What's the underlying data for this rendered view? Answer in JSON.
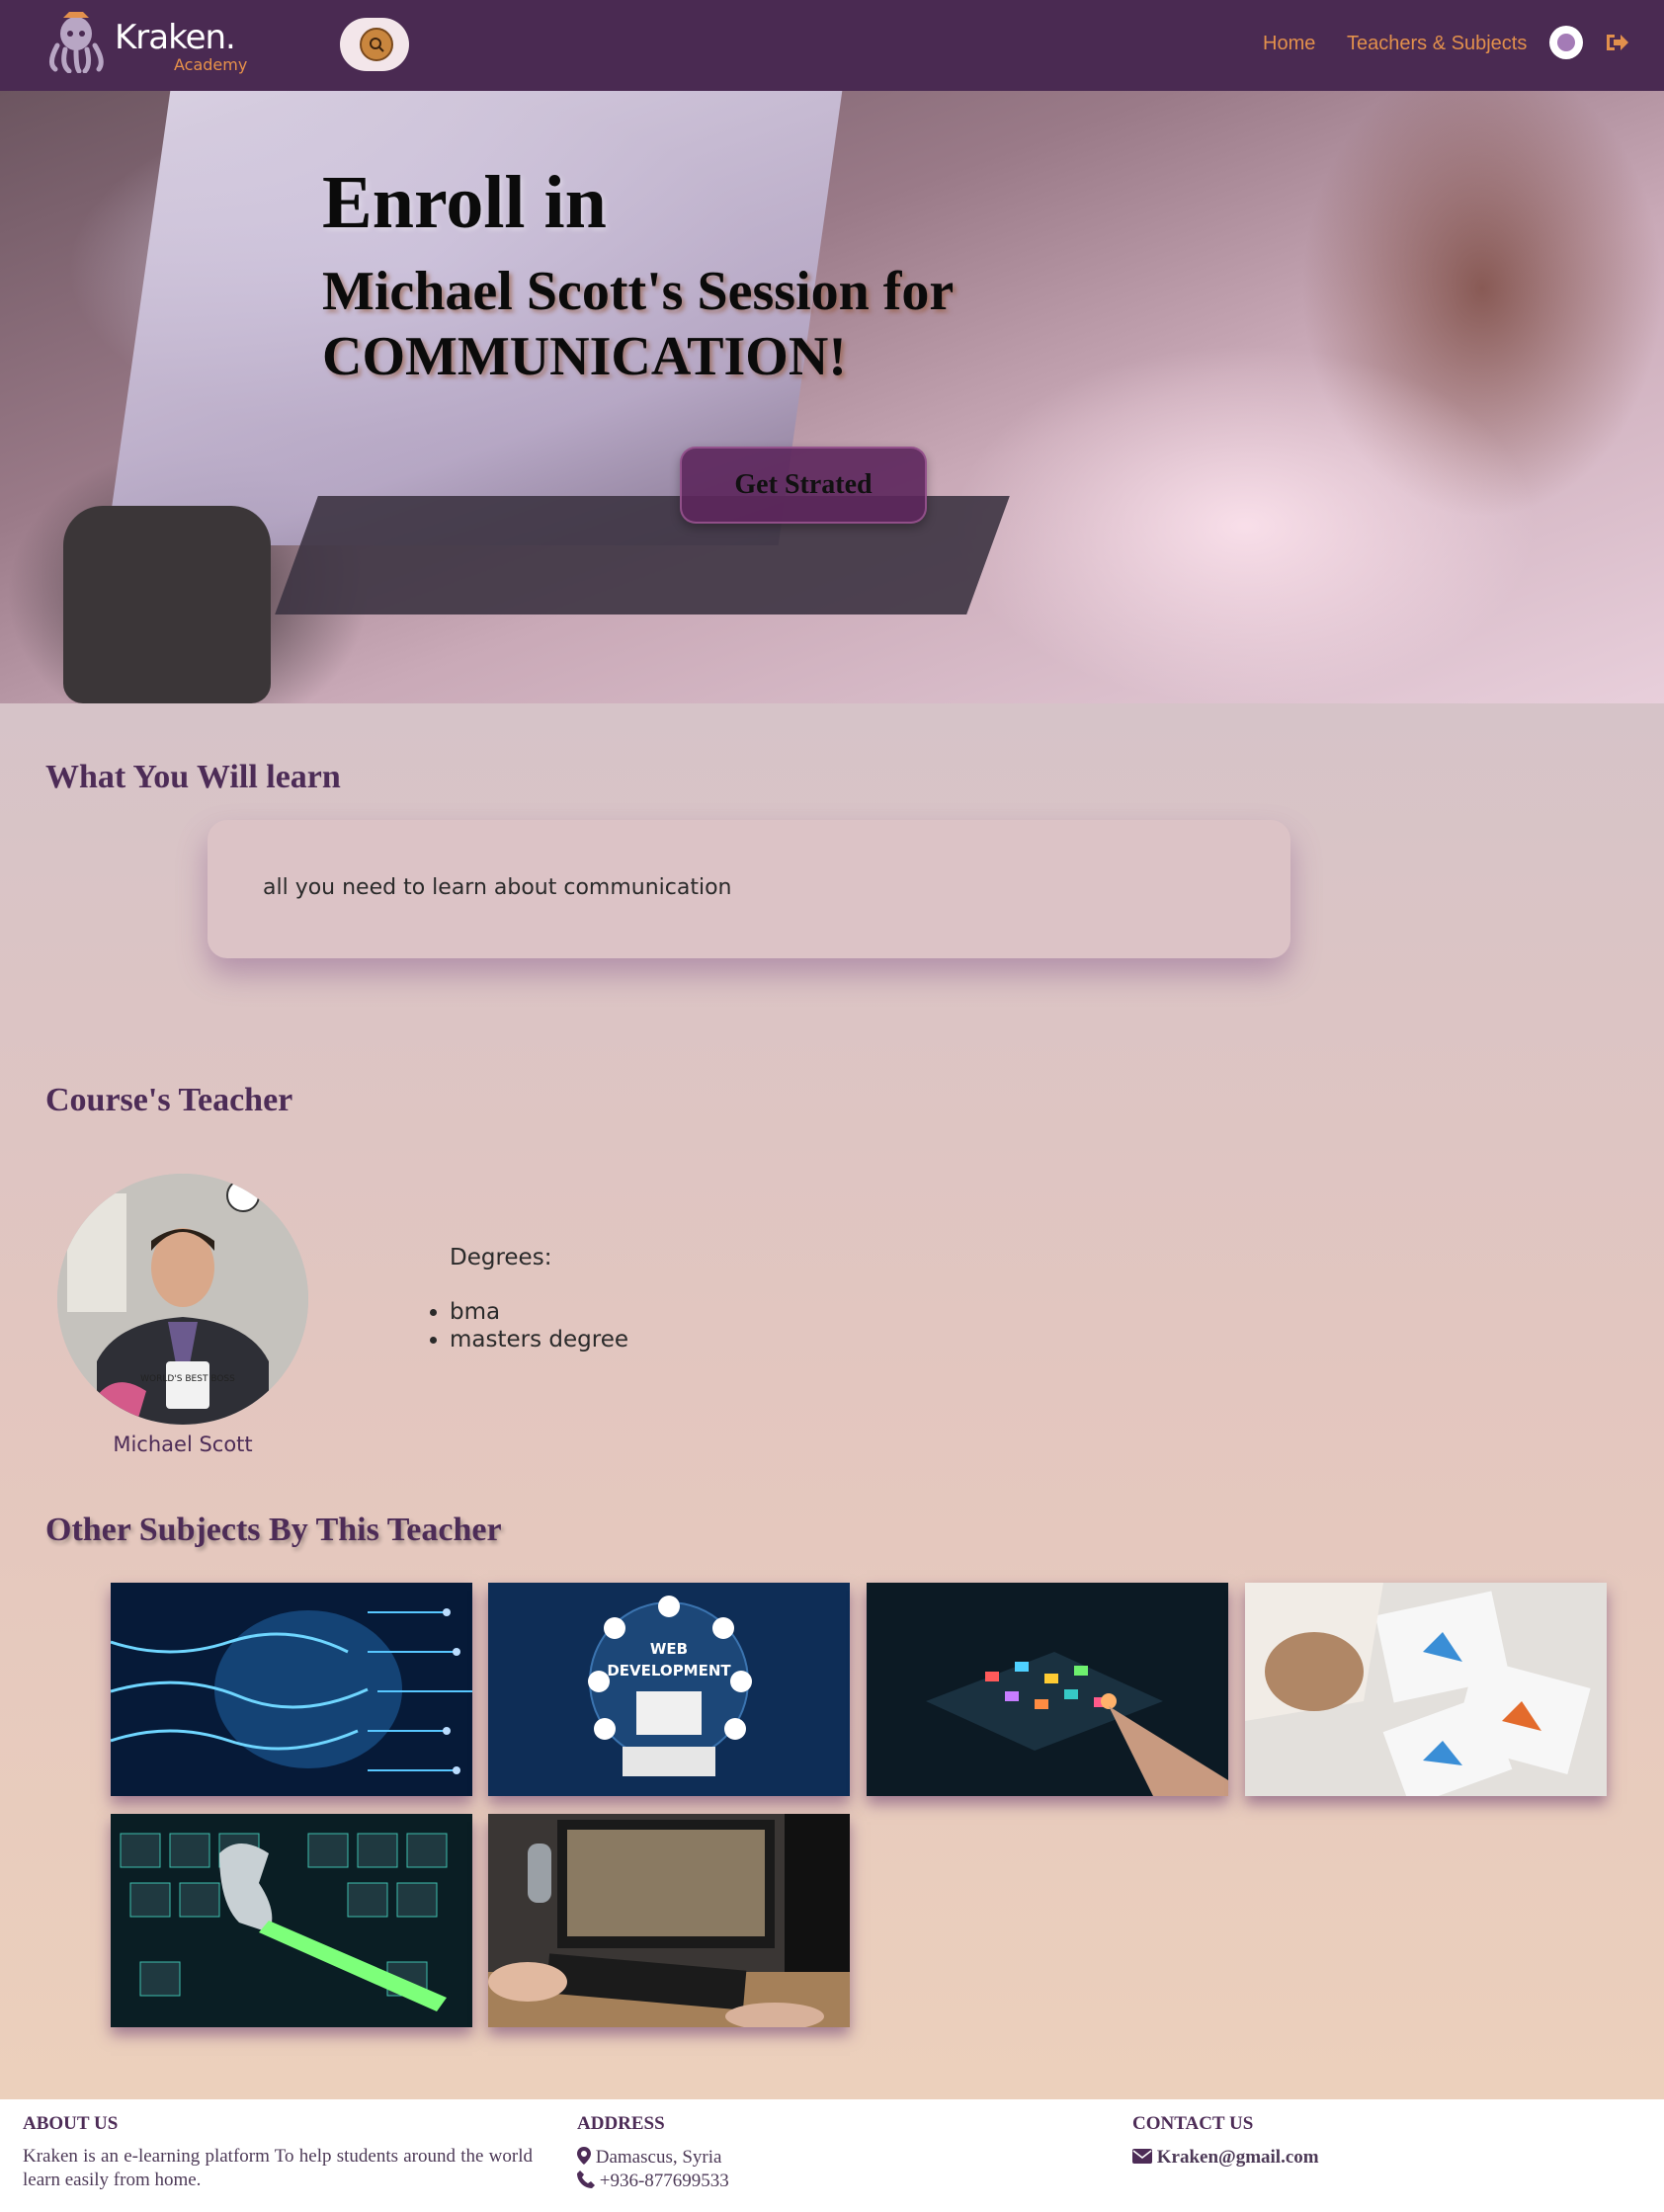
{
  "brand": {
    "name": "Kraken.",
    "sub": "Academy"
  },
  "nav": {
    "links": [
      {
        "label": "Home"
      },
      {
        "label": "Teachers & Subjects"
      }
    ]
  },
  "hero": {
    "title_line1": "Enroll in",
    "title_line2": "Michael Scott's Session for COMMUNICATION!",
    "cta_label": "Get Strated"
  },
  "learn": {
    "title": "What You Will learn",
    "description": "all you need to learn about communication"
  },
  "teacher": {
    "section_title": "Course's Teacher",
    "name": "Michael Scott",
    "mug_text": "WORLD'S BEST BOSS",
    "degrees_label": "Degrees:",
    "degrees": [
      "bma",
      "masters degree"
    ]
  },
  "other_subjects": {
    "title": "Other Subjects By This Teacher",
    "cards": [
      {
        "icon": "ai-brain-circuit-icon"
      },
      {
        "icon": "web-development-icon",
        "caption_line1": "WEB",
        "caption_line2": "DEVELOPMENT"
      },
      {
        "icon": "digital-tablet-icon"
      },
      {
        "icon": "data-analytics-icon"
      },
      {
        "icon": "keyboard-wrench-icon"
      },
      {
        "icon": "computer-desk-icon"
      }
    ]
  },
  "footer": {
    "about": {
      "heading": "ABOUT US",
      "text": "Kraken is an e-learning platform To help students around the world learn easily from home."
    },
    "address": {
      "heading": "ADDRESS",
      "location": "Damascus, Syria",
      "phone": "+936-877699533"
    },
    "contact": {
      "heading": "CONTACT US",
      "email": "Kraken@gmail.com"
    }
  },
  "colors": {
    "nav_bg": "#4a2a52",
    "accent": "#e2904c",
    "heading": "#4d2c57"
  }
}
